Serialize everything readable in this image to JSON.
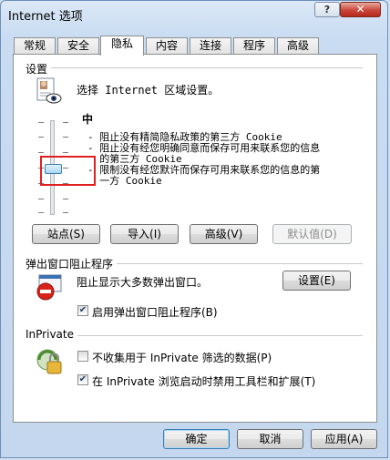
{
  "window": {
    "title": "Internet 选项",
    "help_glyph": "?",
    "close_glyph": "✕"
  },
  "tabs": [
    {
      "label": "常规"
    },
    {
      "label": "安全"
    },
    {
      "label": "隐私"
    },
    {
      "label": "内容"
    },
    {
      "label": "连接"
    },
    {
      "label": "程序"
    },
    {
      "label": "高级"
    }
  ],
  "settings": {
    "group_label": "设置",
    "prompt": "选择 Internet 区域设置。",
    "level": "中",
    "level_fraction": 0.5,
    "bullets": [
      "- 阻止没有精简隐私政策的第三方 Cookie",
      "- 阻止没有经您明确同意而保存可用来联系您的信息",
      "  的第三方 Cookie",
      "- 限制没有经您默许而保存可用来联系您的信息的第",
      "  一方 Cookie"
    ],
    "buttons": {
      "sites": "站点(S)",
      "import": "导入(I)",
      "advanced": "高级(V)",
      "default": "默认值(D)"
    }
  },
  "popup_blocker": {
    "group_label": "弹出窗口阻止程序",
    "text": "阻止显示大多数弹出窗口。",
    "settings_button": "设置(E)",
    "enable_label": "启用弹出窗口阻止程序(B)",
    "enable_checked": true
  },
  "inprivate": {
    "group_label": "InPrivate",
    "option1_label": "不收集用于 InPrivate 筛选的数据(P)",
    "option1_checked": false,
    "option2_label": "在 InPrivate 浏览启动时禁用工具栏和扩展(T)",
    "option2_checked": true
  },
  "footer": {
    "ok": "确定",
    "cancel": "取消",
    "apply": "应用(A)"
  }
}
